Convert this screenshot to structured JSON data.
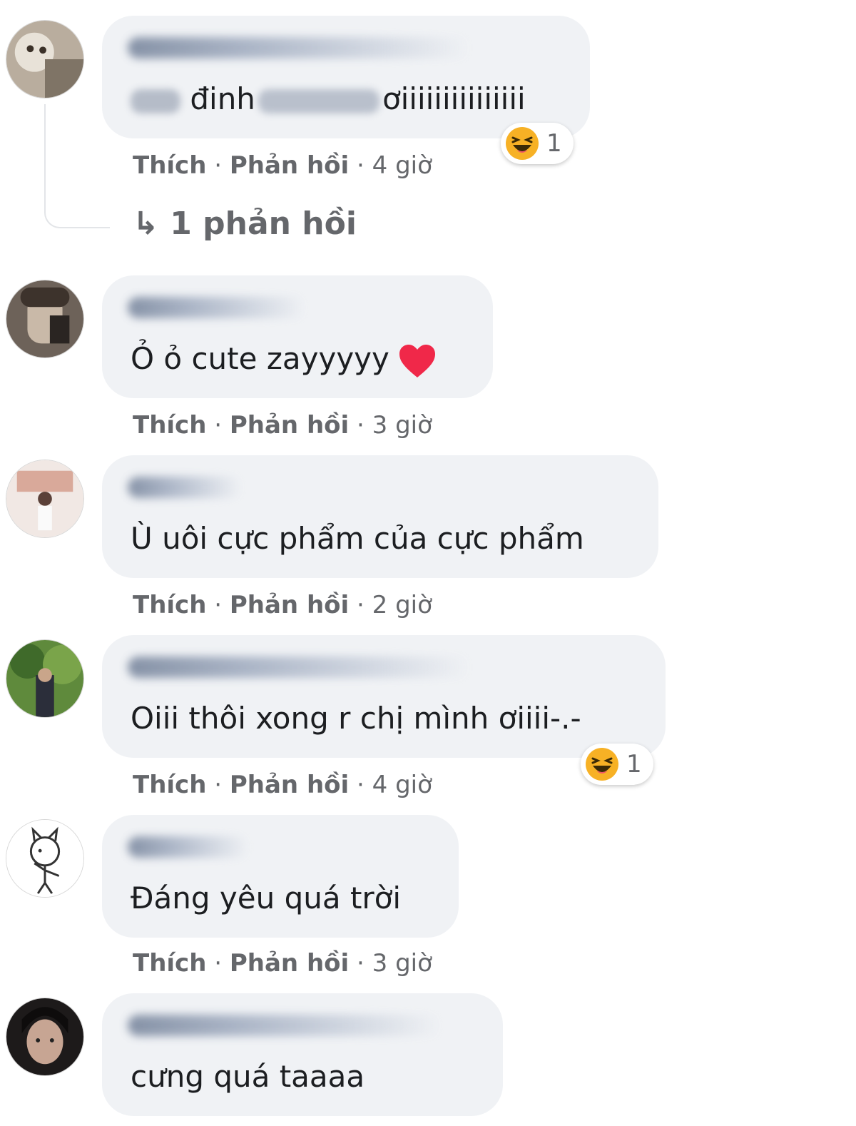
{
  "actions": {
    "like": "Thích",
    "reply": "Phản hồi",
    "separator": "·"
  },
  "comments": [
    {
      "text_before": "đinh",
      "text_after": "ơiiiiiiiiiiiiiii",
      "time": "4 giờ",
      "reaction_count": "1",
      "reaction_icon": "haha-icon"
    },
    {
      "text": "Ỏ ỏ cute zayyyyy",
      "emoji": "heart-icon",
      "time": "3 giờ"
    },
    {
      "text": "Ù uôi cực phẩm của cực phẩm",
      "time": "2 giờ"
    },
    {
      "text": "Oiii thôi xong r chị mình ơiiii-.-",
      "time": "4 giờ",
      "reaction_count": "1",
      "reaction_icon": "haha-icon"
    },
    {
      "text": "Đáng yêu quá trời",
      "time": "3 giờ"
    },
    {
      "text": "cưng quá taaaa"
    }
  ],
  "replies_link": "1 phản hồi",
  "replies_arrow": "↳",
  "colors": {
    "bubble": "#f0f2f5",
    "meta": "#65676b",
    "text": "#1c1e21",
    "heart": "#f02849",
    "haha": "#f7b125"
  }
}
